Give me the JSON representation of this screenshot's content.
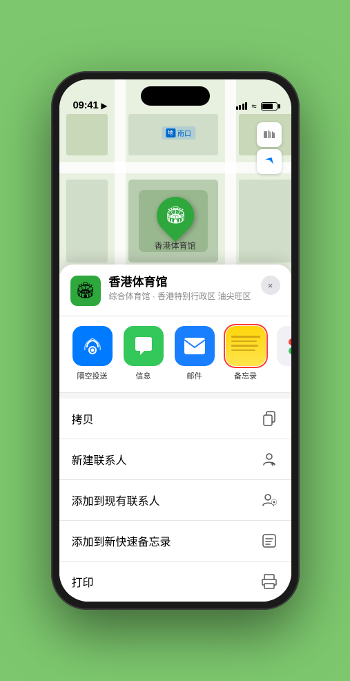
{
  "status_bar": {
    "time": "09:41",
    "location_arrow": "▶"
  },
  "map": {
    "label_icon": "南口",
    "label_prefix": "南口",
    "venue_pin_emoji": "🏟",
    "venue_name": "香港体育馆",
    "control_map": "🗺",
    "control_location": "↗"
  },
  "place_card": {
    "icon_emoji": "🏟",
    "name": "香港体育馆",
    "subtitle": "综合体育馆 · 香港特别行政区 油尖旺区",
    "close_label": "×"
  },
  "share_items": [
    {
      "id": "airdrop",
      "label": "隔空投送",
      "type": "airdrop"
    },
    {
      "id": "message",
      "label": "信息",
      "type": "message"
    },
    {
      "id": "mail",
      "label": "邮件",
      "type": "mail"
    },
    {
      "id": "notes",
      "label": "备忘录",
      "type": "notes",
      "highlighted": true
    },
    {
      "id": "more",
      "label": "提",
      "type": "more"
    }
  ],
  "actions": [
    {
      "id": "copy",
      "label": "拷贝",
      "icon": "copy"
    },
    {
      "id": "new-contact",
      "label": "新建联系人",
      "icon": "person"
    },
    {
      "id": "add-existing",
      "label": "添加到现有联系人",
      "icon": "person-add"
    },
    {
      "id": "quick-note",
      "label": "添加到新快速备忘录",
      "icon": "note"
    },
    {
      "id": "print",
      "label": "打印",
      "icon": "print"
    }
  ]
}
